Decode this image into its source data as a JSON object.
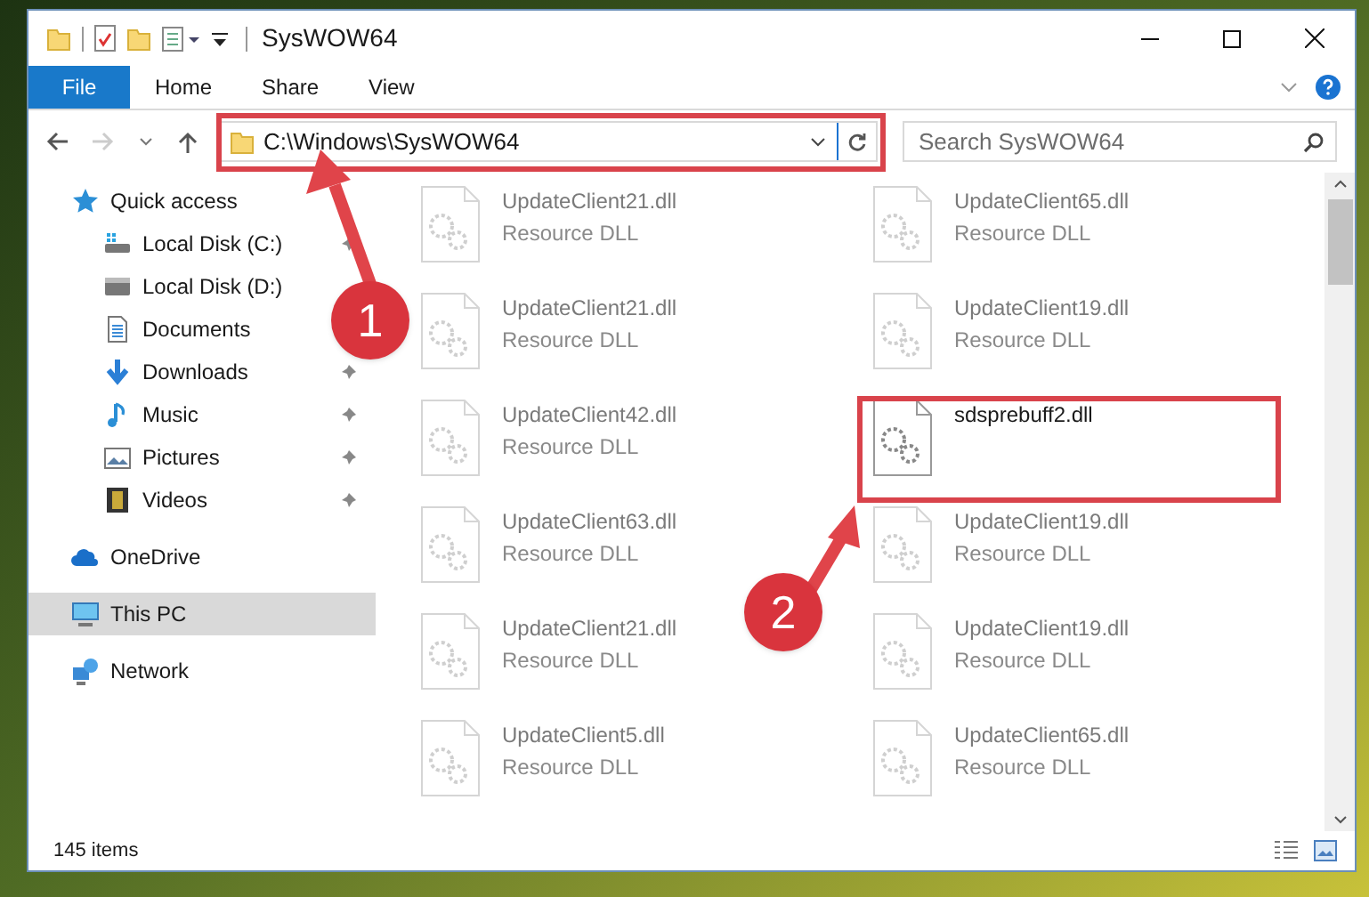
{
  "window": {
    "title": "SysWOW64"
  },
  "ribbon_tabs": [
    {
      "label": "File",
      "kind": "file"
    },
    {
      "label": "Home",
      "kind": "tab"
    },
    {
      "label": "Share",
      "kind": "tab"
    },
    {
      "label": "View",
      "kind": "tab"
    }
  ],
  "address": {
    "path": "C:\\Windows\\SysWOW64"
  },
  "search": {
    "placeholder": "Search SysWOW64"
  },
  "nav": [
    {
      "label": "Quick access",
      "kind": "star",
      "selected": false,
      "children": [
        {
          "label": "Local Disk (C:)",
          "kind": "system-drive",
          "pinned": true,
          "selected": false
        },
        {
          "label": "Local Disk (D:)",
          "kind": "drive",
          "pinned": false,
          "selected": false
        },
        {
          "label": "Documents",
          "kind": "documents",
          "pinned": false,
          "selected": false
        },
        {
          "label": "Downloads",
          "kind": "downloads",
          "pinned": true,
          "selected": false
        },
        {
          "label": "Music",
          "kind": "music",
          "pinned": true,
          "selected": false
        },
        {
          "label": "Pictures",
          "kind": "pictures",
          "pinned": true,
          "selected": false
        },
        {
          "label": "Videos",
          "kind": "videos",
          "pinned": true,
          "selected": false
        }
      ]
    },
    {
      "label": "OneDrive",
      "kind": "cloud",
      "selected": false
    },
    {
      "label": "This PC",
      "kind": "pc",
      "selected": true
    },
    {
      "label": "Network",
      "kind": "network",
      "selected": false
    }
  ],
  "files": [
    {
      "name": "UpdateClient21.dll",
      "type": "Resource DLL",
      "dimmed": true
    },
    {
      "name": "UpdateClient65.dll",
      "type": "Resource DLL",
      "dimmed": true
    },
    {
      "name": "UpdateClient21.dll",
      "type": "Resource DLL",
      "dimmed": true
    },
    {
      "name": "UpdateClient19.dll",
      "type": "Resource DLL",
      "dimmed": true
    },
    {
      "name": "UpdateClient42.dll",
      "type": "Resource DLL",
      "dimmed": true
    },
    {
      "name": "sdsprebuff2.dll",
      "dimmed": false
    },
    {
      "name": "UpdateClient63.dll",
      "type": "Resource DLL",
      "dimmed": true
    },
    {
      "name": "UpdateClient19.dll",
      "type": "Resource DLL",
      "dimmed": true
    },
    {
      "name": "UpdateClient21.dll",
      "type": "Resource DLL",
      "dimmed": true
    },
    {
      "name": "UpdateClient19.dll",
      "type": "Resource DLL",
      "dimmed": true
    },
    {
      "name": "UpdateClient5.dll",
      "type": "Resource DLL",
      "dimmed": true
    },
    {
      "name": "UpdateClient65.dll",
      "type": "Resource DLL",
      "dimmed": true
    }
  ],
  "status_bar": {
    "item_count": "145 items"
  },
  "annotations": [
    {
      "number": "1"
    },
    {
      "number": "2"
    }
  ]
}
